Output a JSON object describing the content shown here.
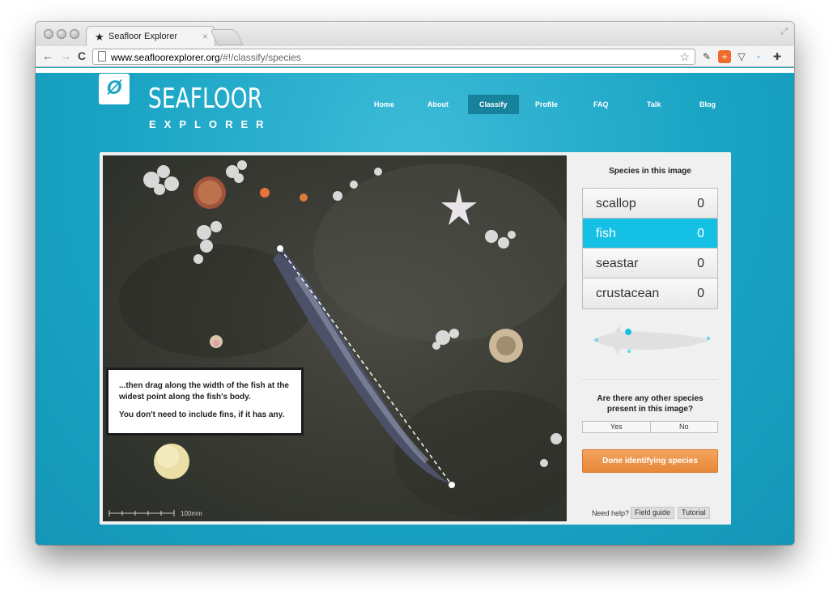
{
  "browser": {
    "tab_title": "Seafloor Explorer",
    "tab_close": "×",
    "url_domain": "www.seafloorexplorer.org",
    "url_path": "/#!/classify/species",
    "nav_back": "←",
    "nav_forward": "→",
    "nav_reload": "C"
  },
  "site": {
    "logo_glyph": "Ø",
    "logo_main": "SEAFLOOR",
    "logo_sub": "EXPLORER",
    "nav": [
      {
        "label": "Home"
      },
      {
        "label": "About"
      },
      {
        "label": "Classify",
        "active": true
      },
      {
        "label": "Profile"
      },
      {
        "label": "FAQ"
      },
      {
        "label": "Talk"
      },
      {
        "label": "Blog"
      }
    ]
  },
  "image": {
    "tutorial_p1": "...then drag along the width of the fish at the widest point along the fish's body.",
    "tutorial_p2": "You don't need to include fins, if it has any.",
    "scale_label": "100mm"
  },
  "sidebar": {
    "title": "Species in this image",
    "species": [
      {
        "name": "scallop",
        "count": "0"
      },
      {
        "name": "fish",
        "count": "0",
        "active": true
      },
      {
        "name": "seastar",
        "count": "0"
      },
      {
        "name": "crustacean",
        "count": "0"
      }
    ],
    "question": "Are there any other species present in this image?",
    "yes_label": "Yes",
    "no_label": "No",
    "done_label": "Done identifying species",
    "help_text": "Need help?",
    "field_guide_label": "Field guide",
    "tutorial_label": "Tutorial"
  },
  "colors": {
    "brand": "#1aa4c4",
    "active_nav": "#17829c",
    "active_species": "#14c0e4",
    "done_button": "#ec8d3f"
  }
}
